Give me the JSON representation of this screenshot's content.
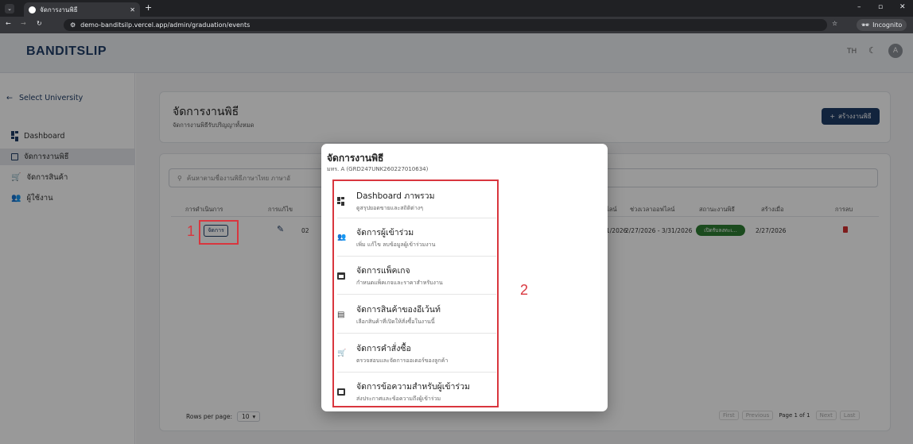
{
  "browser": {
    "tab_title": "จัดการงานพิธี",
    "url": "demo-banditsilp.vercel.app/admin/graduation/events",
    "incognito": "Incognito"
  },
  "app": {
    "logo": "BANDITSLIP",
    "lang": "TH",
    "avatar": "A"
  },
  "sidebar": {
    "back": "Select University",
    "items": [
      {
        "label": "Dashboard",
        "icon": "dashboard-icon"
      },
      {
        "label": "จัดการงานพิธี",
        "icon": "calendar-icon",
        "active": true
      },
      {
        "label": "จัดการสินค้า",
        "icon": "cart-icon"
      },
      {
        "label": "ผู้ใช้งาน",
        "icon": "users-icon"
      }
    ]
  },
  "page": {
    "title": "จัดการงานพิธี",
    "subtitle": "จัดการงานพิธีรับปริญญาทั้งหมด",
    "create_btn": "สร้างงานพิธี",
    "search_placeholder": "ค้นหาตามชื่องานพิธีภาษาไทย ภาษาอั"
  },
  "table": {
    "headers": [
      "การดำเนินการ",
      "การแก้ไข",
      "ไลน์",
      "ช่วงเวลาออฟไลน์",
      "สถานะงานพิธี",
      "สร้างเมื่อ",
      "การลบ"
    ],
    "row": {
      "manage_btn": "จัดการ",
      "frag": "02",
      "online_frag": "1/2026",
      "offline_range": "2/27/2026 - 3/31/2026",
      "status": "เปิดรับลงทะเ...",
      "created": "2/27/2026"
    },
    "rows_per_page_label": "Rows per page:",
    "rows_per_page": "10",
    "pager": {
      "first": "First",
      "prev": "Previous",
      "page": "Page 1 of 1",
      "next": "Next",
      "last": "Last"
    }
  },
  "modal": {
    "title": "จัดการงานพิธี",
    "subtitle": "มทร. A (GRD247UNK260227010634)",
    "items": [
      {
        "title": "Dashboard ภาพรวม",
        "sub": "ดูสรุปยอดขายและสถิติต่างๆ",
        "icon": "dashboard-icon"
      },
      {
        "title": "จัดการผู้เข้าร่วม",
        "sub": "เพิ่ม แก้ไข ลบข้อมูลผู้เข้าร่วมงาน",
        "icon": "people-icon"
      },
      {
        "title": "จัดการแพ็คเกจ",
        "sub": "กำหนดแพ็คเกจและราคาสำหรับงาน",
        "icon": "archive-icon"
      },
      {
        "title": "จัดการสินค้าของอีเว้นท์",
        "sub": "เลือกสินค้าที่เปิดให้สั่งซื้อในงานนี้",
        "icon": "store-icon"
      },
      {
        "title": "จัดการคำสั่งซื้อ",
        "sub": "ตรวจสอบและจัดการออเดอร์ของลูกค้า",
        "icon": "cart-icon"
      },
      {
        "title": "จัดการข้อความสำหรับผู้เข้าร่วม",
        "sub": "ส่งประกาศและข้อความถึงผู้เข้าร่วม",
        "icon": "message-icon"
      }
    ]
  },
  "annotations": {
    "one": "1",
    "two": "2"
  },
  "colors": {
    "primary": "#1f3c66",
    "status_green": "#2e7d32",
    "annotation_red": "#d9363e",
    "delete_red": "#d32f2f"
  }
}
